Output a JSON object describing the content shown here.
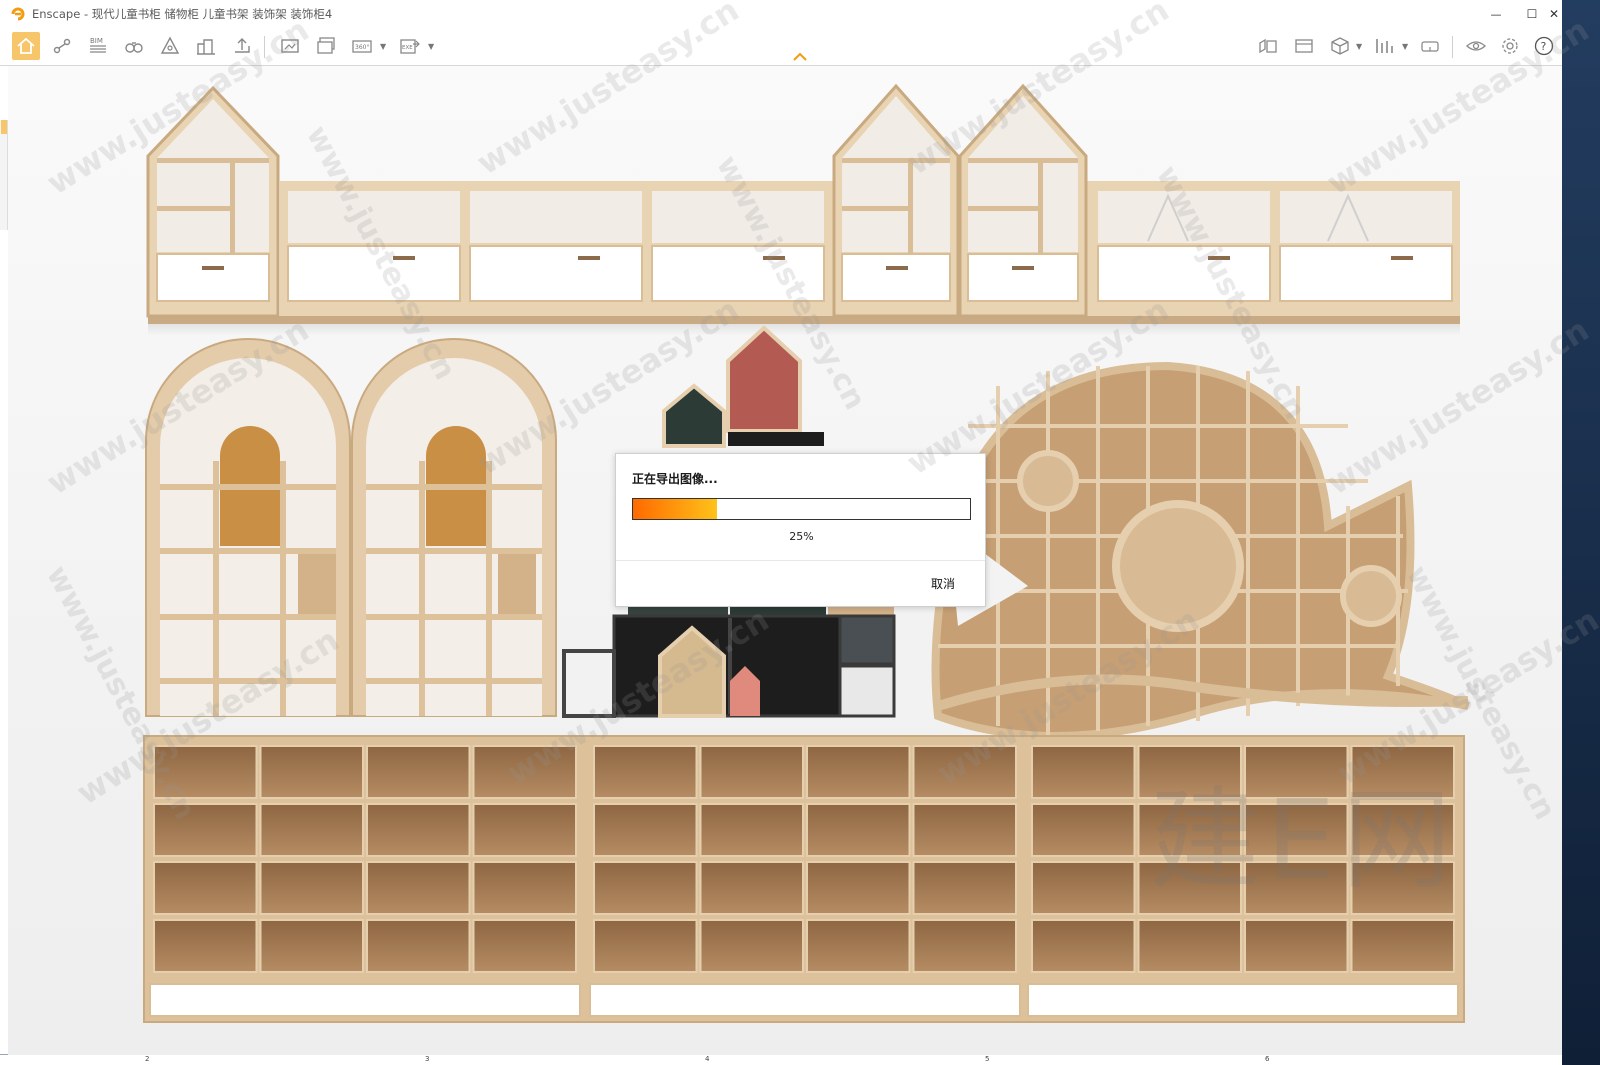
{
  "window": {
    "title": "Enscape - 现代儿童书柜 储物柜 儿童书架 装饰架 装饰柜4",
    "logo_icon": "enscape-logo-icon",
    "controls": {
      "minimize": "—",
      "maximize": "☐",
      "close": "✕"
    }
  },
  "toolbar": {
    "accent_color": "#f7c56a",
    "buttons": [
      {
        "name": "home-button",
        "icon": "home-icon"
      },
      {
        "name": "views-button",
        "icon": "waypoints-icon"
      },
      {
        "name": "bim-button",
        "icon": "bim-icon",
        "label": "BIM"
      },
      {
        "name": "binoculars-button",
        "icon": "binoculars-icon"
      },
      {
        "name": "materials-button",
        "icon": "asset-icon"
      },
      {
        "name": "sites-button",
        "icon": "buildings-icon"
      },
      {
        "name": "upload-button",
        "icon": "upload-icon"
      },
      {
        "name": "screenshot-button",
        "icon": "screenshot-icon"
      },
      {
        "name": "batch-render-button",
        "icon": "batch-render-icon"
      },
      {
        "name": "panorama-button",
        "icon": "panorama-360-icon",
        "label": "360°"
      },
      {
        "name": "export-button",
        "icon": "export-exe-icon",
        "label": "EXE"
      },
      {
        "name": "visual-settings-button",
        "icon": "visual-settings-icon"
      },
      {
        "name": "capture-button",
        "icon": "capture-icon"
      },
      {
        "name": "cube-button",
        "icon": "cube-icon"
      },
      {
        "name": "graph-button",
        "icon": "graph-icon"
      },
      {
        "name": "vr-button",
        "icon": "vr-headset-icon"
      },
      {
        "name": "visibility-button",
        "icon": "eye-icon"
      },
      {
        "name": "settings-button",
        "icon": "gear-icon"
      },
      {
        "name": "help-button",
        "icon": "help-icon",
        "label": "?"
      }
    ]
  },
  "dialog": {
    "title": "正在导出图像...",
    "progress": 0.25,
    "progress_label": "25%",
    "cancel_label": "取消",
    "progress_color_start": "#ff6a00",
    "progress_color_end": "#ffc21a"
  },
  "ruler": {
    "ticks": [
      "2",
      "3",
      "4",
      "5",
      "6"
    ]
  },
  "watermark": {
    "url_text": "www.justeasy.cn",
    "brand_text": "建E网",
    "short_text": "建E网"
  },
  "scene_colors": {
    "wood": "#e3cba8",
    "wood_dark": "#b9946b",
    "shelf_inner": "#f0ebe3",
    "drawer": "#ffffff",
    "cubby_inner": "#a87f59",
    "cork": "#c98f45",
    "red": "#b35a52",
    "green": "#2c3b36",
    "pink": "#e08a7d",
    "black": "#1d1d1d"
  }
}
